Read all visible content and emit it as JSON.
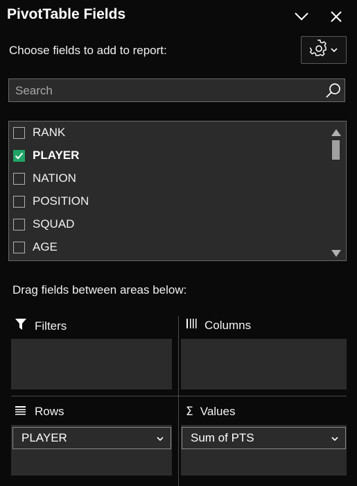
{
  "header": {
    "title": "PivotTable Fields",
    "collapse_icon": "chevron-down-icon",
    "close_icon": "close-icon"
  },
  "subtitle": "Choose fields to add to report:",
  "settings": {
    "icon": "gear-icon",
    "dropdown_icon": "chevron-down-icon"
  },
  "search": {
    "placeholder": "Search",
    "value": "",
    "icon": "search-icon"
  },
  "fields": [
    {
      "label": "RANK",
      "checked": false
    },
    {
      "label": "PLAYER",
      "checked": true
    },
    {
      "label": "NATION",
      "checked": false
    },
    {
      "label": "POSITION",
      "checked": false
    },
    {
      "label": "SQUAD",
      "checked": false
    },
    {
      "label": "AGE",
      "checked": false
    }
  ],
  "drag_label": "Drag fields between areas below:",
  "areas": {
    "filters": {
      "title": "Filters",
      "icon": "filter-icon"
    },
    "columns": {
      "title": "Columns",
      "icon": "columns-icon"
    },
    "rows": {
      "title": "Rows",
      "icon": "rows-icon",
      "items": [
        "PLAYER"
      ]
    },
    "values": {
      "title": "Values",
      "icon": "sigma-icon",
      "items": [
        "Sum of PTS"
      ]
    }
  },
  "colors": {
    "accent_check": "#21a366",
    "panel_bg": "#0a0a0a",
    "box_bg": "#2b2b2b"
  }
}
